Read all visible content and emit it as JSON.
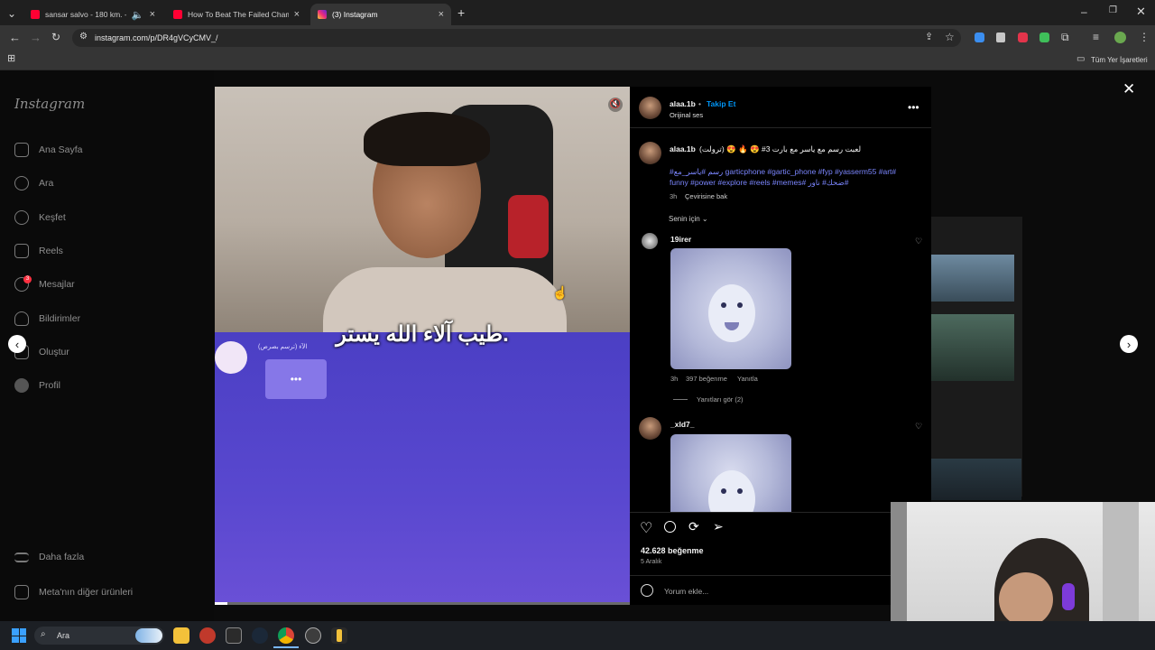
{
  "browser": {
    "tabs": [
      {
        "title": "sansar salvo - 180 km. - You",
        "favicon_color": "#ff0033"
      },
      {
        "title": "How To Beat The Failed Champ",
        "favicon_color": "#ff0033"
      },
      {
        "title": "(3) Instagram",
        "favicon_color": "#e1306c"
      }
    ],
    "new_tab_icon": "plus-icon",
    "url": "instagram.com/p/DR4gVCyCMV_/",
    "bookmarks_label": "Tüm Yer İşaretleri"
  },
  "sidebar": {
    "logo": "Instagram",
    "items": [
      {
        "label": "Ana Sayfa",
        "icon": "home-icon"
      },
      {
        "label": "Ara",
        "icon": "search-icon"
      },
      {
        "label": "Keşfet",
        "icon": "compass-icon"
      },
      {
        "label": "Reels",
        "icon": "reels-icon"
      },
      {
        "label": "Mesajlar",
        "icon": "messenger-icon",
        "badge": "3"
      },
      {
        "label": "Bildirimler",
        "icon": "heart-icon"
      },
      {
        "label": "Oluştur",
        "icon": "plus-square-icon"
      },
      {
        "label": "Profil",
        "icon": "avatar-icon"
      }
    ],
    "more": "Daha fazla",
    "meta": "Meta'nın diğer ürünleri"
  },
  "video": {
    "subtitle": "طيب آلاء الله يستر.",
    "game_label": "الآء (ترسم بصرص)",
    "typing_dots": "•••"
  },
  "post": {
    "username": "alaa.1b",
    "follow": "Takip Et",
    "audio": "Orijinal ses",
    "caption_user": "alaa.1b",
    "caption": "لعبت رسم مع ياسر مع بارت 3# 😍 🔥 😍 (ترولت)",
    "hashtags_line1": "#رسم #ياسر_مع garticphone #gartic_phone #fyp #yasserm55 #art#",
    "hashtags_line2": "funny #power #explore #reels #memes# ضحك# ناور#",
    "caption_time": "3h",
    "translate": "Çevirisine bak",
    "sort": "Senin için",
    "comments": [
      {
        "user": "19irer",
        "time": "3h",
        "likes": "397 beğenme",
        "reply": "Yanıtla",
        "view_replies": "Yanıtları gör (2)"
      },
      {
        "user": "_xld7_"
      }
    ],
    "likes": "42.628 beğenme",
    "date": "5 Aralık",
    "add_comment_placeholder": "Yorum ekle..."
  },
  "taskbar": {
    "search_label": "Ara"
  },
  "colors": {
    "accent_blue": "#0095f6",
    "hashtag_blue": "#7b86ff",
    "video_purple": "#5a48d0"
  }
}
